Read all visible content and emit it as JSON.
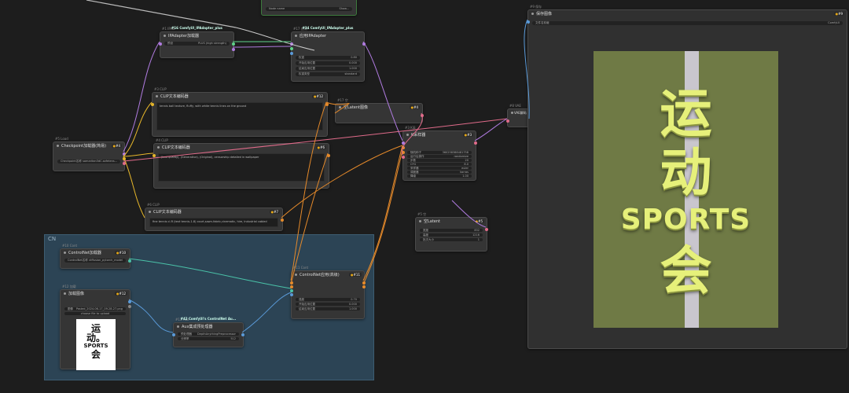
{
  "nodes": {
    "ipadapter_loader": {
      "tag": "#1 IPAD",
      "sub": "#16 ComfyUI_IPAdapter_plus",
      "title": "IPAdapter加载器",
      "widget_label": "预设",
      "widget_value": "PLUS (high strength)"
    },
    "apply_ipadapter": {
      "tag": "#17 应用",
      "sub": "#34 ComfyUI_IPAdapter_plus",
      "title": "应用IPAdapter",
      "rows": [
        {
          "label": "权重",
          "value": "0.80"
        },
        {
          "label": "开始应用位置",
          "value": "0.000"
        },
        {
          "label": "结束应用位置",
          "value": "1.000"
        },
        {
          "label": "权重类型",
          "value": "standard"
        }
      ]
    },
    "clip_pos": {
      "tag": "#3 CLIP",
      "badge": "#12",
      "title": "CLIP文本编码器",
      "text": "tennis ball texture, fluffy, with white tennis lines on the ground"
    },
    "clip_neg": {
      "tag": "#4 CLIP",
      "badge": "#6",
      "title": "CLIP文本编码器",
      "text": "(bad quality), (Generative), (Original), censorship detailed in wallpaper"
    },
    "clip_third": {
      "tag": "#6 CLIP",
      "badge": "#7",
      "title": "CLIP文本编码器",
      "text": "fine tennis cl.R  (text tennis-1.8) court,sawn-fabric,cinematic, hire, Industrial cabled"
    },
    "checkpoint": {
      "tag": "#5 Load",
      "badge": "#4",
      "title": "Checkpoint加载器(简易)",
      "widget_label": "Checkpoint名称",
      "widget_value": "samaritan3dC.safetens..."
    },
    "empty_latent": {
      "tag": "#17 空",
      "badge": "#4",
      "title": "空Latent图像"
    },
    "ksampler": {
      "tag": "#3 K采",
      "badge": "#3",
      "title": "K采样器",
      "rows": [
        {
          "label": "随机种子",
          "value": "360258388481758"
        },
        {
          "label": "运行后操作",
          "value": "randomize"
        },
        {
          "label": "步数",
          "value": "20"
        },
        {
          "label": "CFG",
          "value": "8.0"
        },
        {
          "label": "采样器",
          "value": "euler"
        },
        {
          "label": "调度器",
          "value": "karras"
        },
        {
          "label": "降噪",
          "value": "1.00"
        }
      ]
    },
    "vae_decode": {
      "tag": "#8 VAE",
      "badge": "#8",
      "title": "VAE解码"
    },
    "save_image": {
      "tag": "#9 保存",
      "badge": "#9",
      "title": "保存图像",
      "widget_label": "文件名前缀",
      "widget_value": "ComfyUI"
    },
    "latent_node": {
      "tag": "#5 空",
      "badge": "#5",
      "title": "空Latent",
      "rows": [
        {
          "label": "宽度",
          "value": "832"
        },
        {
          "label": "高度",
          "value": "1216"
        },
        {
          "label": "批次大小",
          "value": "1"
        }
      ]
    },
    "controlnet_loader": {
      "tag": "#10 Cont",
      "badge": "#10",
      "title": "ControlNet加载器",
      "widget_label": "ControlNet名称",
      "widget_value": "diffusion_pytorch_model"
    },
    "controlnet_apply": {
      "tag": "#11 Cont",
      "badge": "#11",
      "title": "ControlNet应用(高级)",
      "rows": [
        {
          "label": "强度",
          "value": "0.70"
        },
        {
          "label": "开始应用位置",
          "value": "0.000"
        },
        {
          "label": "结束应用位置",
          "value": "1.000"
        }
      ]
    },
    "load_image": {
      "tag": "#12 加载",
      "badge": "#12",
      "title": "加载图像",
      "widget_label": "图像",
      "widget_value": "Pasted_2024-06-17_09-28-27.png",
      "upload_label": "choose file to upload"
    },
    "aux": {
      "tag": "#13 Aux",
      "sub": "#42 ComfyUI's ControlNet Au...",
      "title": "Aux集成预处理器",
      "rows": [
        {
          "label": "预处理器",
          "value": "DepthAnythingPreprocessor"
        },
        {
          "label": "分辨率",
          "value": "512"
        }
      ]
    },
    "top_node": {
      "label": "Node name",
      "value": "Show..."
    }
  },
  "group": {
    "title": "CN"
  },
  "poster": {
    "line1": "运",
    "line2": "动。",
    "line3": "SPORTS",
    "line4": "会"
  },
  "preview_image": {
    "line1": "运",
    "line2": "动",
    "line3": "SPORTS",
    "line4": "会"
  },
  "colors": {
    "model": "#b07be0",
    "clip": "#e6b62a",
    "conditioning": "#e68a2a",
    "latent": "#e06b8a",
    "vae": "#e06b6b",
    "image": "#5a9ad8",
    "ipadapter": "#5fd38a",
    "controlnet": "#4ac2a8"
  }
}
